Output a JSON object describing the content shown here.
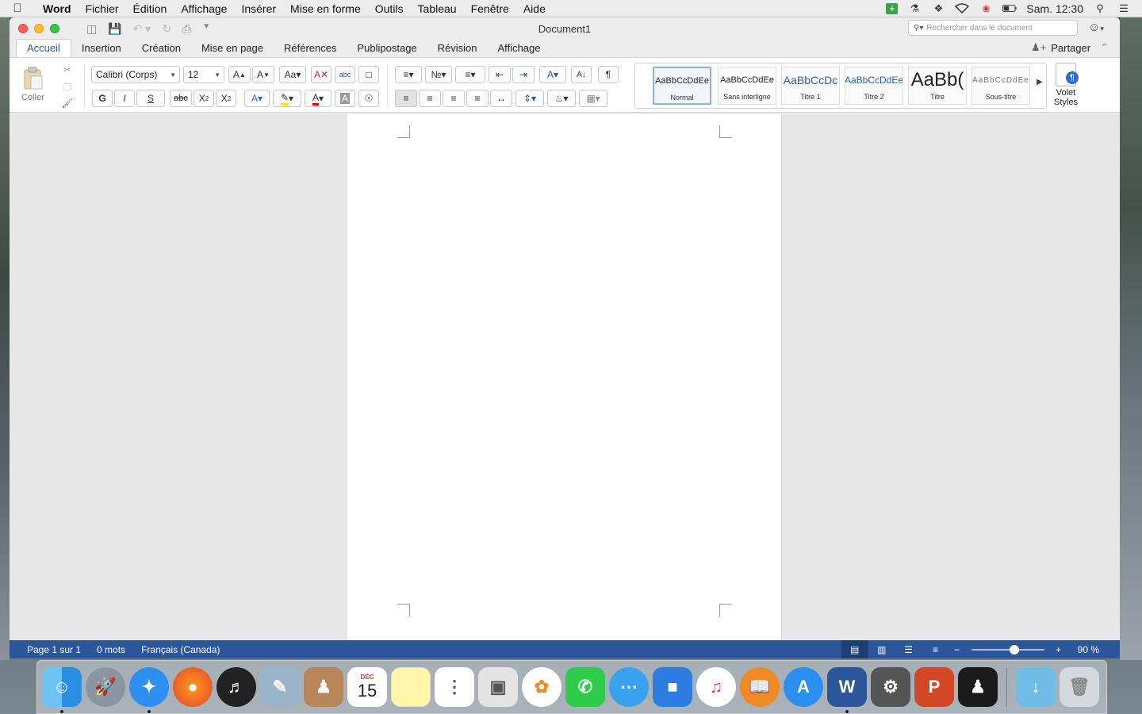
{
  "menubar": {
    "app": "Word",
    "items": [
      "Fichier",
      "Édition",
      "Affichage",
      "Insérer",
      "Mise en forme",
      "Outils",
      "Tableau",
      "Fenêtre",
      "Aide"
    ],
    "clock": "Sam. 12:30"
  },
  "window": {
    "title": "Document1",
    "search_placeholder": "Rechercher dans le document"
  },
  "tabs": [
    "Accueil",
    "Insertion",
    "Création",
    "Mise en page",
    "Références",
    "Publipostage",
    "Révision",
    "Affichage"
  ],
  "share_label": "Partager",
  "ribbon": {
    "paste_label": "Coller",
    "font_name": "Calibri (Corps)",
    "font_size": "12",
    "bold": "G",
    "italic": "I",
    "underline": "S",
    "strike": "abc",
    "styles": [
      {
        "preview": "AaBbCcDdEe",
        "name": "Normal"
      },
      {
        "preview": "AaBbCcDdEe",
        "name": "Sans interligne"
      },
      {
        "preview": "AaBbCcDc",
        "name": "Titre 1"
      },
      {
        "preview": "AaBbCcDdEe",
        "name": "Titre 2"
      },
      {
        "preview": "AaBb(",
        "name": "Titre"
      },
      {
        "preview": "AaBbCcDdEe",
        "name": "Sous-titre"
      }
    ],
    "styles_pane_label_1": "Volet",
    "styles_pane_label_2": "Styles"
  },
  "status": {
    "page": "Page 1 sur 1",
    "words": "0 mots",
    "language": "Français (Canada)",
    "zoom": "90 %",
    "zoom_level": 0.6
  },
  "dock": {
    "calendar_month": "DÉC",
    "calendar_day": "15"
  }
}
